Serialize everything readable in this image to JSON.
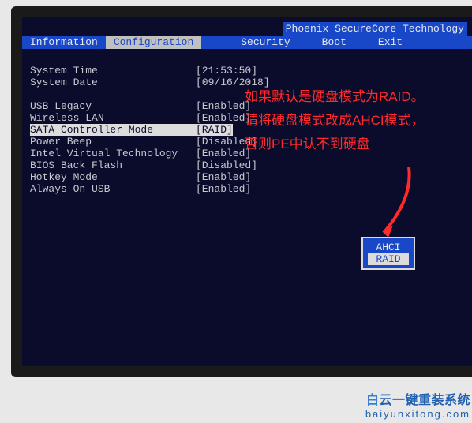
{
  "title": "Phoenix SecureCore Technology",
  "menu": {
    "items": [
      "Information",
      "Configuration",
      "Security",
      "Boot",
      "Exit"
    ],
    "active_index": 1
  },
  "time": {
    "label": "System Time",
    "value": "[21:53:50]"
  },
  "date": {
    "label": "System Date",
    "value": "[09/16/2018]"
  },
  "settings": [
    {
      "label": "USB Legacy",
      "value": "[Enabled]"
    },
    {
      "label": "Wireless LAN",
      "value": "[Enabled]"
    },
    {
      "label": "SATA Controller Mode",
      "value": "[RAID]",
      "selected": true
    },
    {
      "label": "Power Beep",
      "value": "[Disabled]"
    },
    {
      "label": "Intel Virtual Technology",
      "value": "[Enabled]"
    },
    {
      "label": "BIOS Back Flash",
      "value": "[Disabled]"
    },
    {
      "label": "Hotkey Mode",
      "value": "[Enabled]"
    },
    {
      "label": "Always On USB",
      "value": "[Enabled]"
    }
  ],
  "popup": {
    "options": [
      "AHCI",
      "RAID"
    ],
    "selected_index": 1
  },
  "annotations": {
    "line1": "如果默认是硬盘模式为RAID。",
    "line2": "请将硬盘模式改成AHCI模式，",
    "line3": "否则PE中认不到硬盘"
  },
  "watermark": {
    "main_lead": "白",
    "main_rest": "云一键重装系统",
    "sub": "baiyunxitong.com"
  }
}
